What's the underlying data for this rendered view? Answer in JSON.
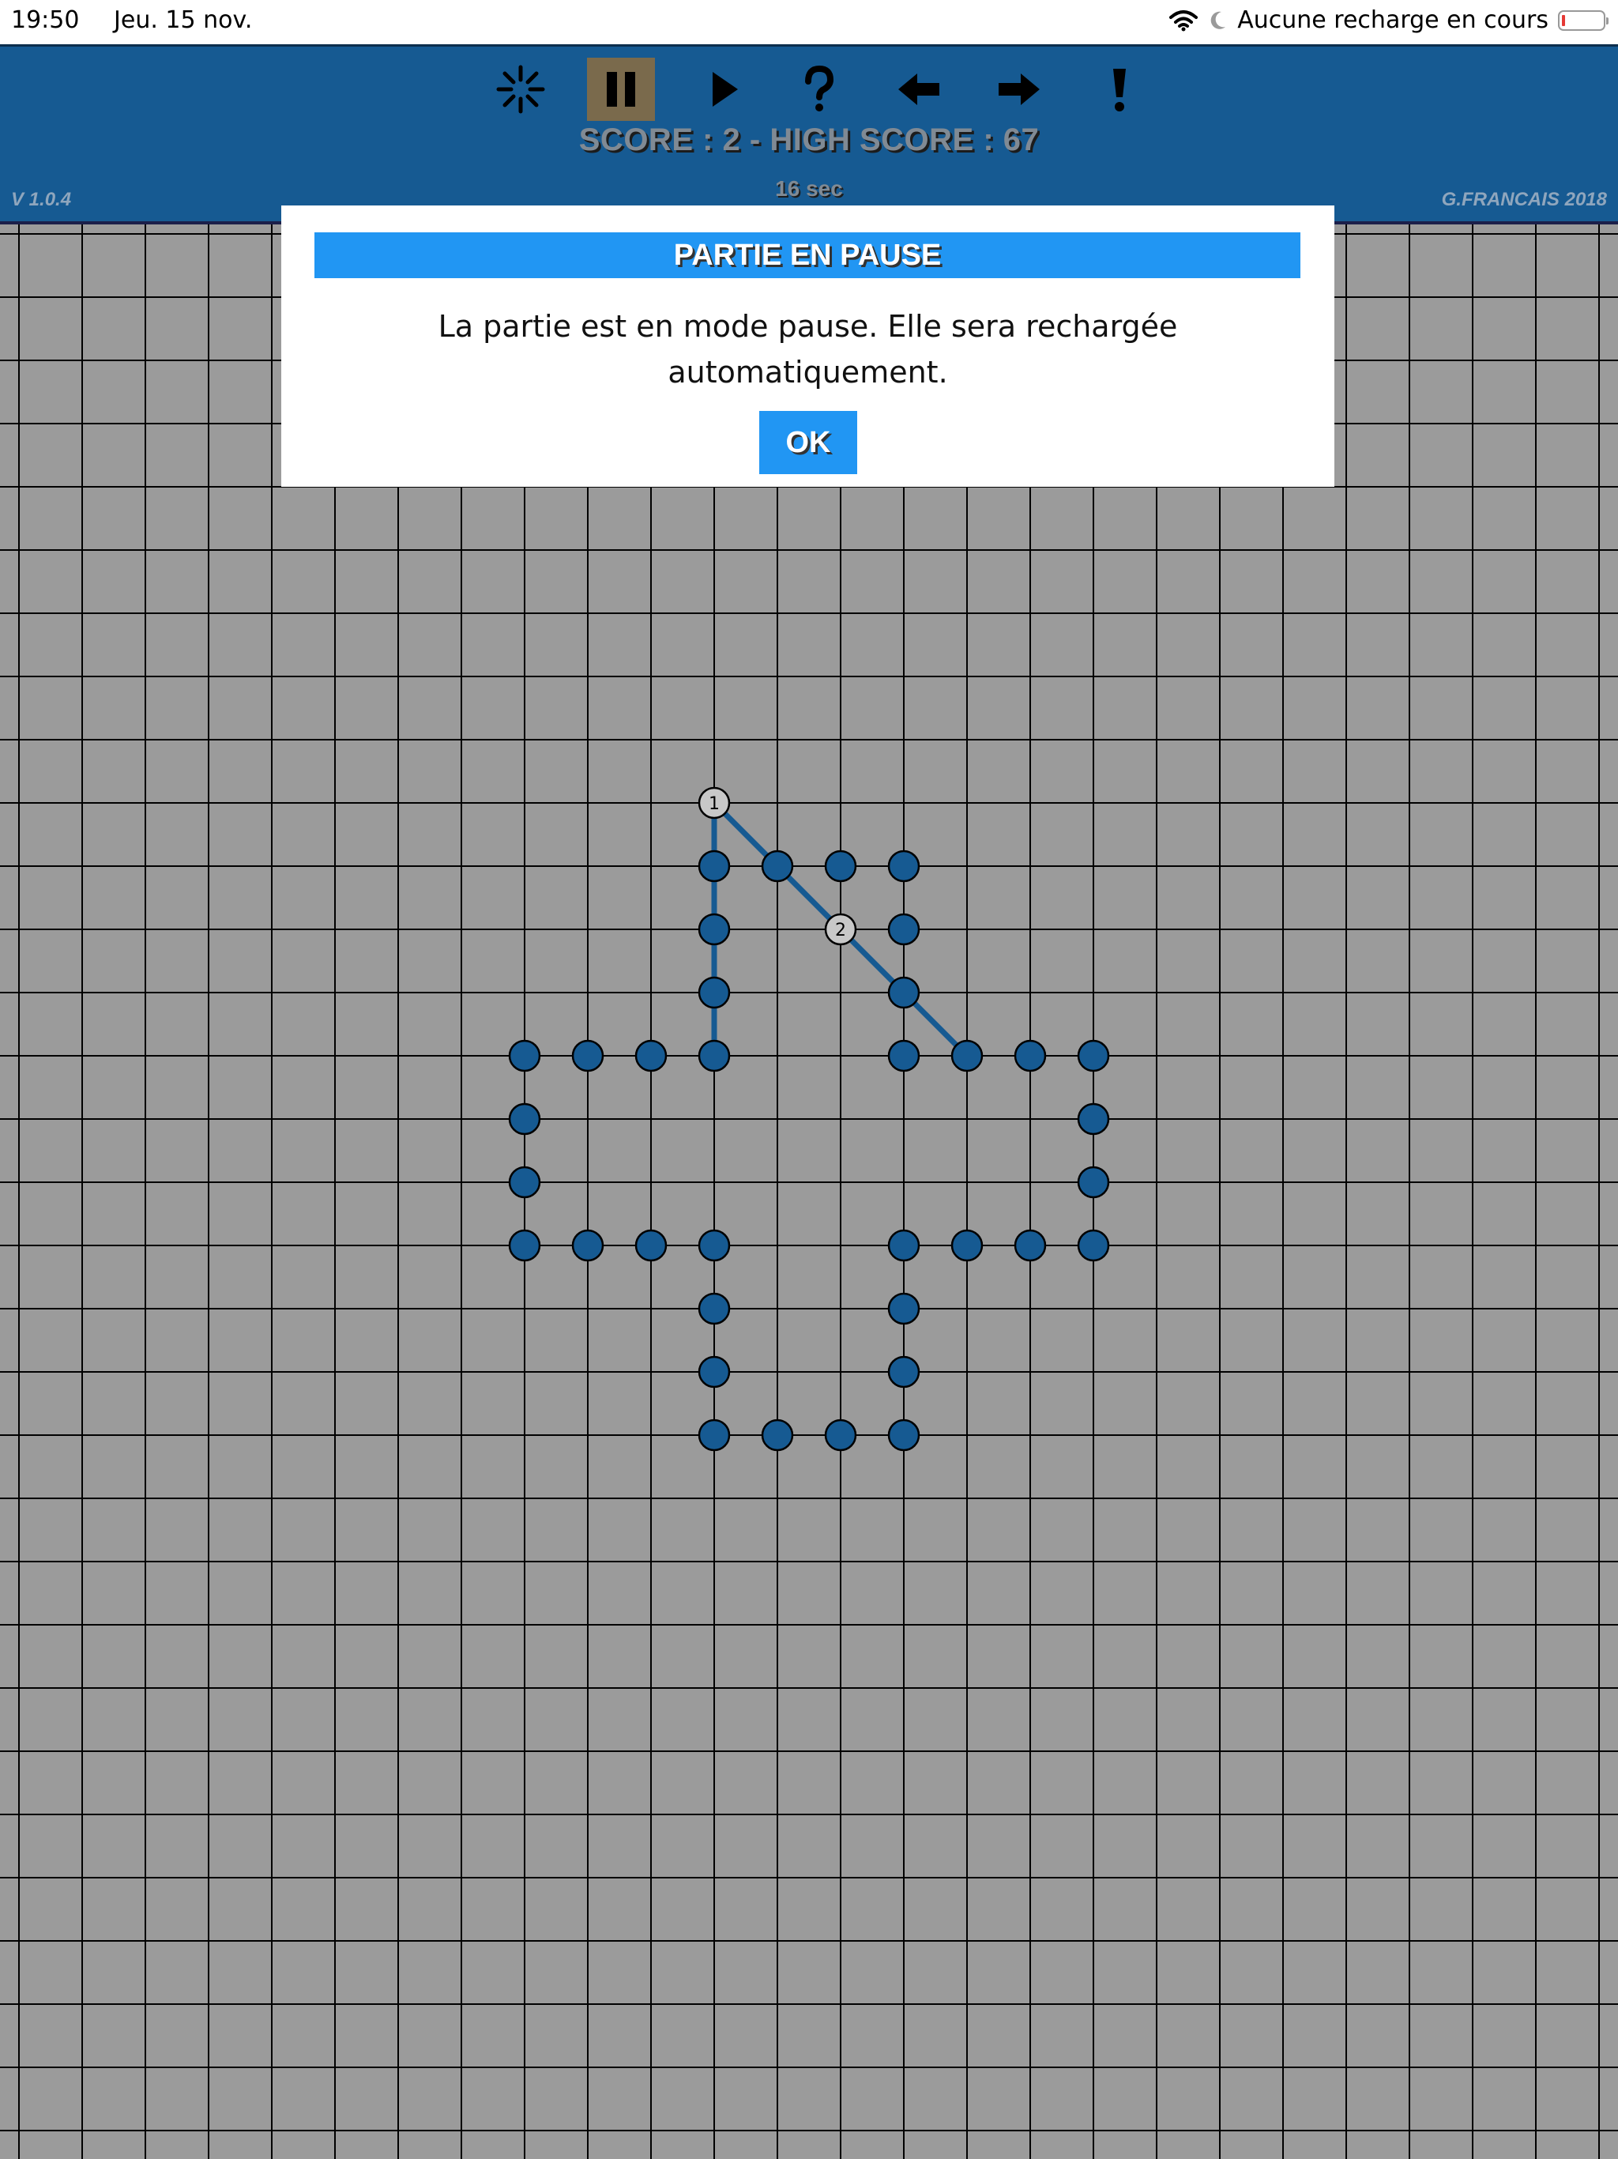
{
  "status_bar": {
    "time": "19:50",
    "date": "Jeu. 15 nov.",
    "charging_text": "Aucune recharge en cours",
    "icons": [
      "wifi-icon",
      "moon-icon",
      "battery-icon"
    ]
  },
  "toolbar": {
    "buttons": [
      {
        "name": "new-game-button",
        "icon": "sparkle-icon"
      },
      {
        "name": "pause-button",
        "icon": "pause-icon",
        "active": true
      },
      {
        "name": "play-button",
        "icon": "play-icon"
      },
      {
        "name": "help-button",
        "icon": "question-icon"
      },
      {
        "name": "undo-button",
        "icon": "arrow-left-icon"
      },
      {
        "name": "redo-button",
        "icon": "arrow-right-icon"
      },
      {
        "name": "hint-button",
        "icon": "exclamation-icon"
      }
    ]
  },
  "header": {
    "score_label": "SCORE : 2",
    "separator": " - ",
    "high_score_label": "HIGH SCORE : 67",
    "timer": "16 sec",
    "version": "V 1.0.4",
    "credits": "G.FRANCAIS 2018"
  },
  "dialog": {
    "title": "PARTIE EN PAUSE",
    "message": "La partie est en mode pause. Elle sera rechargée automatiquement.",
    "ok_label": "OK"
  },
  "board": {
    "columns": 26,
    "rows": 31,
    "colors": {
      "background": "#9b9b9b",
      "grid": "#000000",
      "dot": "#165a92",
      "line": "#165a92",
      "move_dot": "#c8c8c8"
    },
    "dots": [
      [
        11,
        10
      ],
      [
        12,
        10
      ],
      [
        13,
        10
      ],
      [
        14,
        10
      ],
      [
        11,
        11
      ],
      [
        14,
        11
      ],
      [
        11,
        12
      ],
      [
        14,
        12
      ],
      [
        8,
        13
      ],
      [
        9,
        13
      ],
      [
        10,
        13
      ],
      [
        11,
        13
      ],
      [
        14,
        13
      ],
      [
        15,
        13
      ],
      [
        16,
        13
      ],
      [
        17,
        13
      ],
      [
        8,
        14
      ],
      [
        17,
        14
      ],
      [
        8,
        15
      ],
      [
        17,
        15
      ],
      [
        8,
        16
      ],
      [
        9,
        16
      ],
      [
        10,
        16
      ],
      [
        11,
        16
      ],
      [
        14,
        16
      ],
      [
        15,
        16
      ],
      [
        16,
        16
      ],
      [
        17,
        16
      ],
      [
        11,
        17
      ],
      [
        14,
        17
      ],
      [
        11,
        18
      ],
      [
        14,
        18
      ],
      [
        11,
        19
      ],
      [
        12,
        19
      ],
      [
        13,
        19
      ],
      [
        14,
        19
      ]
    ],
    "moves": [
      {
        "number": "1",
        "cell": [
          11,
          9
        ],
        "from": [
          11,
          9
        ],
        "to": [
          11,
          13
        ]
      },
      {
        "number": "2",
        "cell": [
          13,
          11
        ],
        "from": [
          11,
          9
        ],
        "to": [
          15,
          13
        ]
      }
    ]
  }
}
